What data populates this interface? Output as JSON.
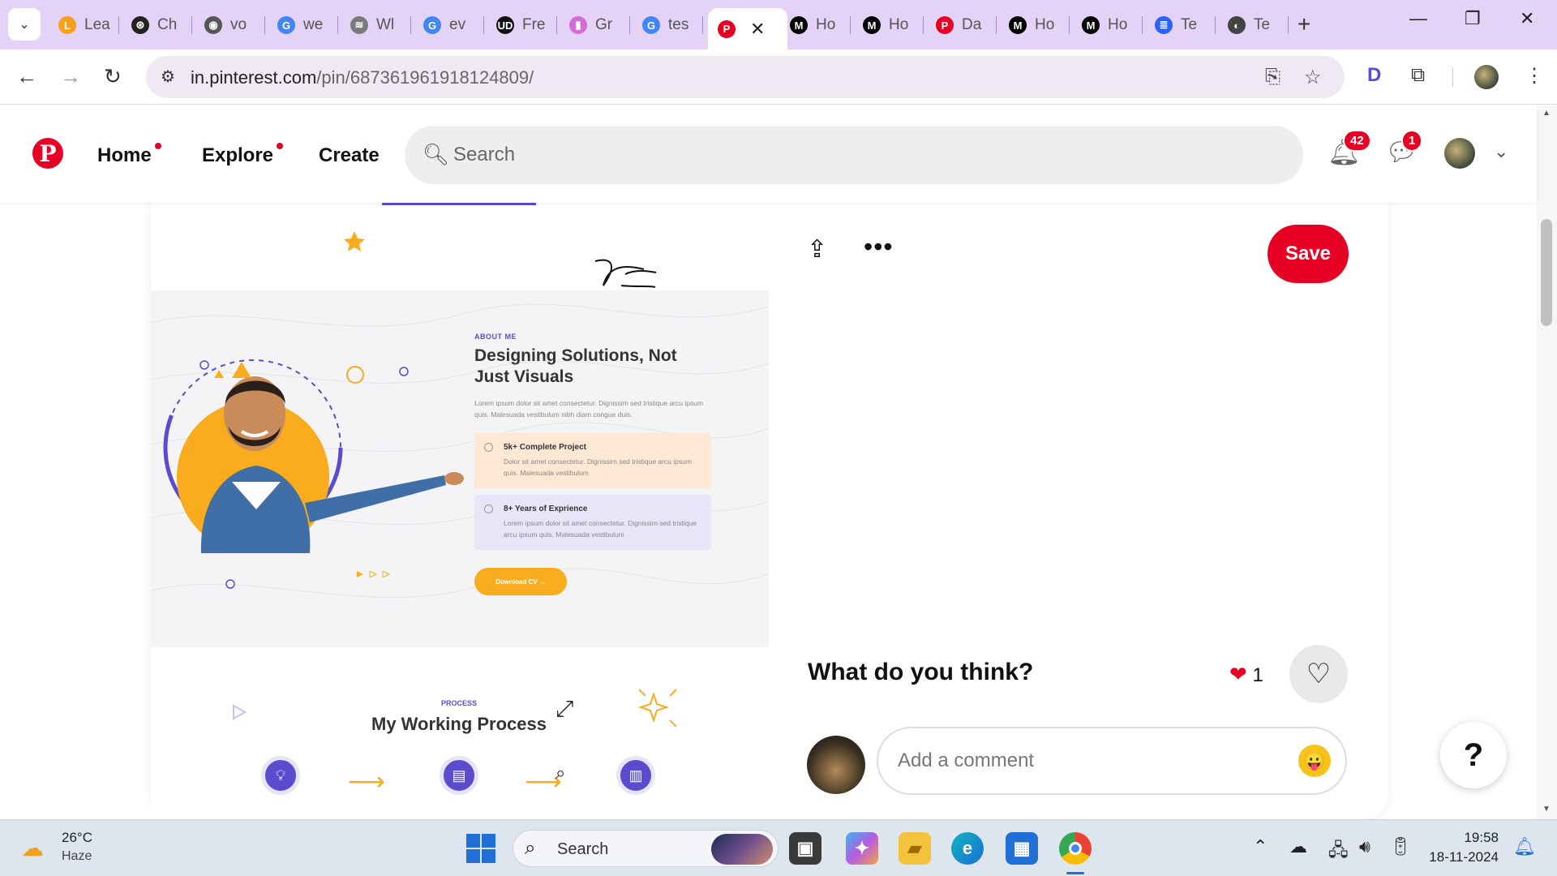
{
  "browser": {
    "tabs": [
      {
        "label": "Lea",
        "icon": "leetcode-icon",
        "color": "#f89f1b"
      },
      {
        "label": "Ch",
        "icon": "chatgpt-icon",
        "color": "#222222"
      },
      {
        "label": "vo",
        "icon": "globe-icon",
        "color": "#555555"
      },
      {
        "label": "we",
        "icon": "google-icon",
        "color": "#4285f4"
      },
      {
        "label": "Wl",
        "icon": "wave-icon",
        "color": "#7a7a7a"
      },
      {
        "label": "ev",
        "icon": "google-icon",
        "color": "#4285f4"
      },
      {
        "label": "Fre",
        "icon": "ud-icon",
        "color": "#111111"
      },
      {
        "label": "Gr",
        "icon": "bag-icon",
        "color": "#d46bd8"
      },
      {
        "label": "tes",
        "icon": "google-icon",
        "color": "#4285f4"
      },
      {
        "label": "Ho",
        "icon": "medium-icon",
        "color": "#000000"
      },
      {
        "label": "Ho",
        "icon": "medium-icon",
        "color": "#000000"
      },
      {
        "label": "Da",
        "icon": "pinterest-icon",
        "color": "#e60023"
      },
      {
        "label": "Ho",
        "icon": "medium-icon",
        "color": "#000000"
      },
      {
        "label": "Ho",
        "icon": "medium-icon",
        "color": "#000000"
      },
      {
        "label": "Te",
        "icon": "stack-icon",
        "color": "#2962ff"
      },
      {
        "label": "Te",
        "icon": "chatbot-icon",
        "color": "#444444"
      }
    ],
    "active_tab_icon": "pinterest-icon",
    "url_host": "in.pinterest.com",
    "url_path": "/pin/687361961918124809/"
  },
  "pinterest": {
    "nav": {
      "home": "Home",
      "explore": "Explore",
      "create": "Create"
    },
    "search_placeholder": "Search",
    "notifications_count": "42",
    "messages_count": "1",
    "save_label": "Save",
    "comments_heading": "What do you think?",
    "reaction_count": "1",
    "comment_placeholder": "Add a comment",
    "help_label": "?",
    "accent": "#e60023"
  },
  "pin_image": {
    "about_tag": "ABOUT ME",
    "headline": "Designing Solutions, Not Just Visuals",
    "intro": "Lorem ipsum dolor sit amet consectetur. Dignissim sed tristique arcu ipsum quis. Malesuada vestibulum nibh diam congue duis.",
    "features": [
      {
        "title": "5k+ Complete Project",
        "desc": "Dolor sit amet consectetur. Dignissim sed tristique arcu ipsum quis. Malesuada vestibulum"
      },
      {
        "title": "8+ Years of Exprience",
        "desc": "Lorem ipsum dolor sit amet consectetur. Dignissim sed tristique arcu ipsum quis. Malesuada vestibulum"
      }
    ],
    "cta": "Download CV →",
    "process_tag": "PROCESS",
    "process_title": "My Working Process"
  },
  "taskbar": {
    "temperature": "26°C",
    "condition": "Haze",
    "search_label": "Search",
    "time": "19:58",
    "date": "18-11-2024"
  }
}
